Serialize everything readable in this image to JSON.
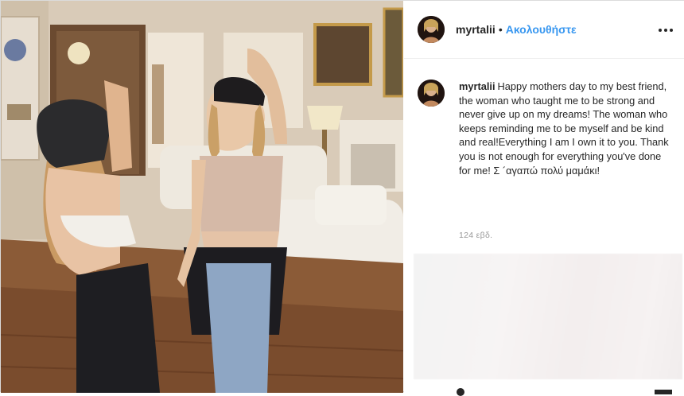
{
  "post": {
    "username": "myrtalii",
    "separator": "•",
    "follow_label": "Ακολουθήστε",
    "more_icon": "more-options-icon"
  },
  "comment": {
    "username": "myrtalii",
    "text": "Happy mothers day to my best friend, the woman who taught me to be strong and never give up on my dreams! The woman who keeps reminding me to be myself and be kind and real!Everything I am I own it to you. Thank you is not enough for everything you've done for me! Σ ´αγαπώ πολύ μαμάκι!",
    "timestamp": "124 εβδ."
  },
  "colors": {
    "follow": "#3897f0",
    "text": "#262626",
    "muted": "#999999",
    "border": "#dbdbdb"
  }
}
